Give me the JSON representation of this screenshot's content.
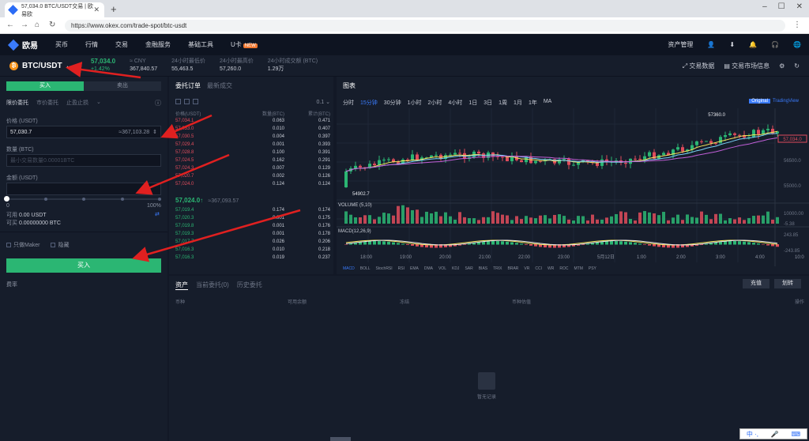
{
  "browser": {
    "tab_title": "57,034.0 BTC/USDT交易 | 欧易欧",
    "url": "https://www.okex.com/trade-spot/btc-usdt"
  },
  "nav": {
    "logo": "欧易",
    "items": [
      "买币",
      "行情",
      "交易",
      "金融服务",
      "基础工具"
    ],
    "special": {
      "label": "U卡",
      "badge": "NEW"
    },
    "right_label": "资产管理"
  },
  "ticker": {
    "pair": "BTC/USDT",
    "price": "57,034.0",
    "change": "+1.42%",
    "stats": [
      {
        "label": "≈ CNY",
        "value": "367,840.57"
      },
      {
        "label": "24小时最低价",
        "value": "55,463.5"
      },
      {
        "label": "24小时最高价",
        "value": "57,260.0"
      },
      {
        "label": "24小时成交额 (BTC)",
        "value": "1.29万"
      }
    ],
    "right": [
      "交易数据",
      "交易市场信息"
    ]
  },
  "order_form": {
    "buy_tab": "买入",
    "sell_tab": "卖出",
    "order_types": [
      "限价委托",
      "市价委托",
      "止盈止损"
    ],
    "price_label": "价格 (USDT)",
    "price_value": "57,030.7",
    "price_cny": "≈367,103.28",
    "amount_label": "数量 (BTC)",
    "amount_placeholder": "最小交易数量0.00001BTC",
    "total_label": "金额 (USDT)",
    "slider_pct": 0,
    "slider_left": "0",
    "slider_right": "100%",
    "available_label": "可用",
    "available_value": "0.00 USDT",
    "canbuy_label": "可买",
    "canbuy_value": "0.00000000 BTC",
    "checks": [
      "只做Maker",
      "隐藏"
    ],
    "buy_button": "买入",
    "fee": "费率"
  },
  "order_book": {
    "tabs": [
      "委托订单",
      "最新成交"
    ],
    "precision": "0.1",
    "headers": [
      "价格(USDT)",
      "数量(BTC)",
      "累计(BTC)"
    ],
    "asks": [
      [
        "57,034.1",
        "0.063",
        "0.471"
      ],
      [
        "57,033.0",
        "0.010",
        "0.407"
      ],
      [
        "57,030.5",
        "0.004",
        "0.397"
      ],
      [
        "57,029.4",
        "0.001",
        "0.393"
      ],
      [
        "57,028.8",
        "0.100",
        "0.391"
      ],
      [
        "57,024.5",
        "0.162",
        "0.291"
      ],
      [
        "57,024.3",
        "0.007",
        "0.129"
      ],
      [
        "57,020.7",
        "0.002",
        "0.126"
      ],
      [
        "57,024.0",
        "0.124",
        "0.124"
      ]
    ],
    "mid_price": "57,024.0",
    "mid_cny": "≈367,093.57",
    "bids": [
      [
        "57,019.4",
        "0.174",
        "0.174"
      ],
      [
        "57,020.3",
        "0.001",
        "0.175"
      ],
      [
        "57,019.8",
        "0.001",
        "0.176"
      ],
      [
        "57,019.3",
        "0.001",
        "0.178"
      ],
      [
        "57,017.7",
        "0.026",
        "0.206"
      ],
      [
        "57,016.3",
        "0.010",
        "0.218"
      ],
      [
        "57,016.3",
        "0.019",
        "0.237"
      ]
    ]
  },
  "chart": {
    "title": "图表",
    "intervals": [
      "分时",
      "15分钟",
      "30分钟",
      "1小时",
      "2小时",
      "4小时",
      "1日",
      "3日",
      "1周",
      "1月",
      "1年",
      "MA"
    ],
    "selected_interval": "15分钟",
    "mode_on": "Original",
    "mode_off": "TradingView",
    "high_label": "57360.0",
    "low_label": "54902.7",
    "last_price": "57,034.0",
    "volume_label": "VOLUME (5,10)",
    "macd_label": "MACD(12,26,9)",
    "x_ticks": [
      "18:00",
      "19:00",
      "20:00",
      "21:00",
      "22:00",
      "23:00",
      "5月12日",
      "1:00",
      "2:00",
      "3:00",
      "4:00",
      "10:0"
    ],
    "y_ticks": [
      "57,034.0",
      "56500.0",
      "55000.0",
      "10000.00",
      "-5.38",
      "243.85",
      "-243.85"
    ],
    "indicators": [
      "MACD",
      "BOLL",
      "StochRSI",
      "RSI",
      "EMA",
      "DMA",
      "VOL",
      "KDJ",
      "SAR",
      "BIAS",
      "TRIX",
      "BRAR",
      "VR",
      "CCI",
      "WR",
      "ROC",
      "MTM",
      "PSY"
    ]
  },
  "assets": {
    "tabs": [
      "资产",
      "当前委托(0)",
      "历史委托"
    ],
    "buttons": [
      "充值",
      "划转"
    ],
    "headers": [
      "币种",
      "可用余额",
      "冻结",
      "币种估值",
      "操作"
    ],
    "empty_text": "暂无记录"
  },
  "ime": "中 ·,"
}
